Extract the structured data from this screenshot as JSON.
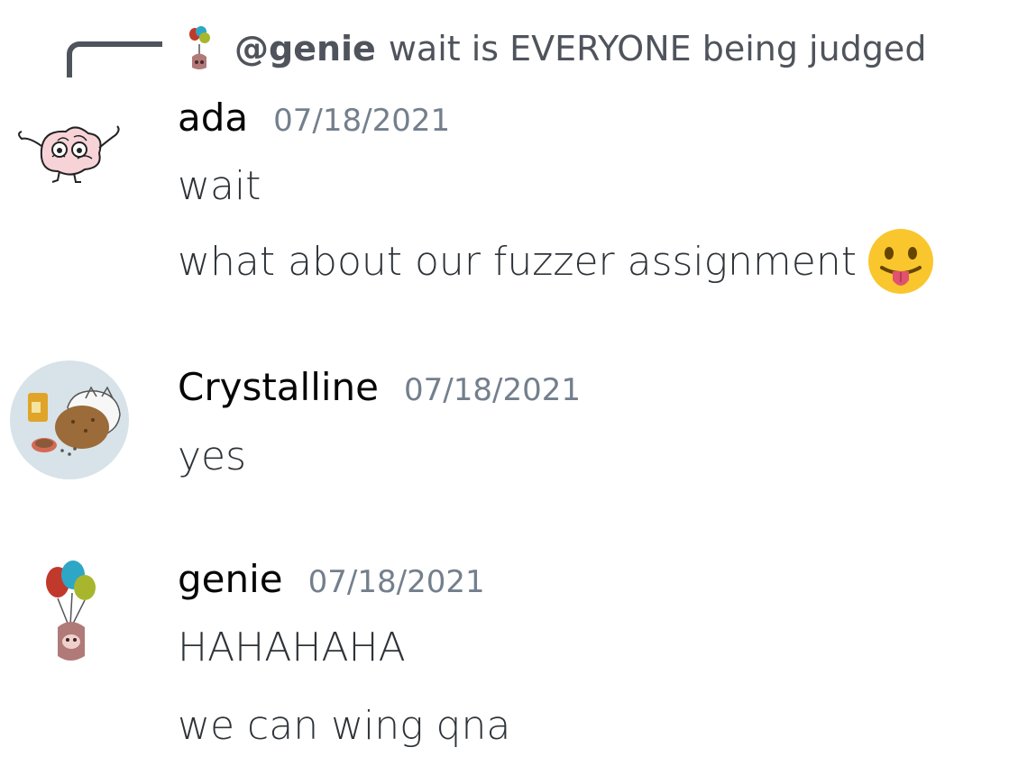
{
  "reply": {
    "mention": "@genie",
    "text": "wait is EVERYONE being judged"
  },
  "messages": [
    {
      "author": "ada",
      "timestamp": "07/18/2021",
      "lines": [
        "wait",
        "what about our fuzzer assignment"
      ],
      "emoji": "stuck-out-tongue-emoji"
    },
    {
      "author": "Crystalline",
      "timestamp": "07/18/2021",
      "lines": [
        "yes"
      ]
    },
    {
      "author": "genie",
      "timestamp": "07/18/2021",
      "lines": [
        "HAHAHAHA",
        "we can wing qna"
      ]
    }
  ],
  "colors": {
    "text": "#2e3338",
    "username": "#060607",
    "timestamp": "#747f8d",
    "reply": "#4f545c",
    "emoji": "#f9c62d"
  }
}
